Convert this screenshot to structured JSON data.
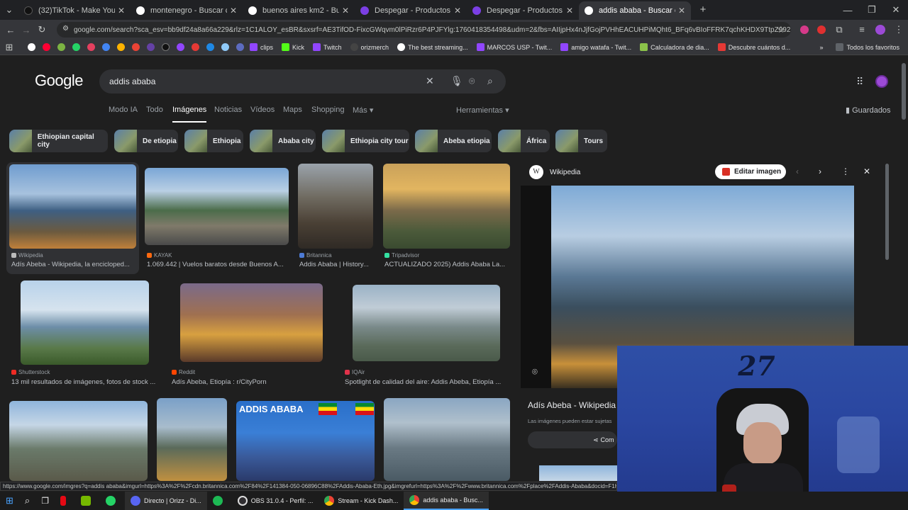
{
  "tabs": [
    {
      "title": "(32)TikTok - Make Your Day",
      "color": "#111111"
    },
    {
      "title": "montenegro - Buscar con Goog",
      "color": "#4285f4"
    },
    {
      "title": "buenos aires km2 - Buscar con",
      "color": "#4285f4"
    },
    {
      "title": "Despegar - Productos Combina",
      "color": "#7b3fe4"
    },
    {
      "title": "Despegar - Productos combine",
      "color": "#7b3fe4"
    },
    {
      "title": "addis ababa - Buscar con Goog",
      "color": "#4285f4"
    }
  ],
  "address": {
    "url": "google.com/search?sca_esv=bb9df24a8a66a229&rlz=1C1ALOY_esBR&sxsrf=AE3TifOD-FixcGWqvm0lPiRzr6P4PJFYlg:1760418354498&udm=2&fbs=AIIjpHx4nJjfGojPVHhEACUHPiMQht6_BFq6vBIoFFRK7qchKHDX9TtpZ992kyQpCWcw0WjqCL..."
  },
  "bookmarks": {
    "items": [
      "clips",
      "Kick",
      "Twitch",
      "orizmerch",
      "The best streaming...",
      "MARCOS USP - Twit...",
      "amigo watafa - Twit...",
      "Calculadora de dia...",
      "Descubre cuántos d..."
    ],
    "all_label": "Todos los favoritos"
  },
  "google": {
    "logo": "Google",
    "query": "addis ababa",
    "nav": [
      "Modo IA",
      "Todo",
      "Imágenes",
      "Noticias",
      "Vídeos",
      "Maps",
      "Shopping",
      "Más"
    ],
    "tools": "Herramientas",
    "saved": "Guardados",
    "chips": [
      "Ethiopian capital city",
      "De etiopia",
      "Ethiopia",
      "Ababa city",
      "Ethiopia city tour",
      "Abeba etiopia",
      "África",
      "Tours"
    ]
  },
  "results": [
    {
      "source": "Wikipedia",
      "caption": "Adís Abeba - Wikipedia, la encicloped..."
    },
    {
      "source": "KAYAK",
      "caption": "1.069.442 | Vuelos baratos desde Buenos A..."
    },
    {
      "source": "Britannica",
      "caption": "Addis Ababa | History..."
    },
    {
      "source": "Tripadvisor",
      "caption": "ACTUALIZADO 2025) Addis Ababa La..."
    },
    {
      "source": "Shutterstock",
      "caption": "13 mil resultados de imágenes, fotos de stock ..."
    },
    {
      "source": "Reddit",
      "caption": "Adís Abeba, Etiopía : r/CityPorn"
    },
    {
      "source": "IQAir",
      "caption": "Spotlight de calidad del aire: Addis Abeba, Etiopía ..."
    }
  ],
  "banner_text": "ADDIS ABABA",
  "panel": {
    "site": "Wikipedia",
    "edit_label": "Editar imagen",
    "title": "Adís Abeba - Wikipedia",
    "notice": "Las imágenes pueden estar sujetas",
    "share_label": "Com"
  },
  "status_url": "https://www.google.com/imgres?q=addis ababa&imgurl=https%3A%2F%2Fcdn.britannica.com%2F84%2F141384-050-06896C88%2FAddis-Ababa-Eth.jpg&imgrefurl=https%3A%2F%2Fwww.britannica.com%2Fplace%2FAddis-Ababa&docid=F1Hm",
  "taskbar": [
    {
      "label": "Directo | Orizz - Di..."
    },
    {
      "label": "OBS 31.0.4 - Perfil: ..."
    },
    {
      "label": "Stream - Kick Dash..."
    },
    {
      "label": "addis ababa - Busc..."
    }
  ]
}
